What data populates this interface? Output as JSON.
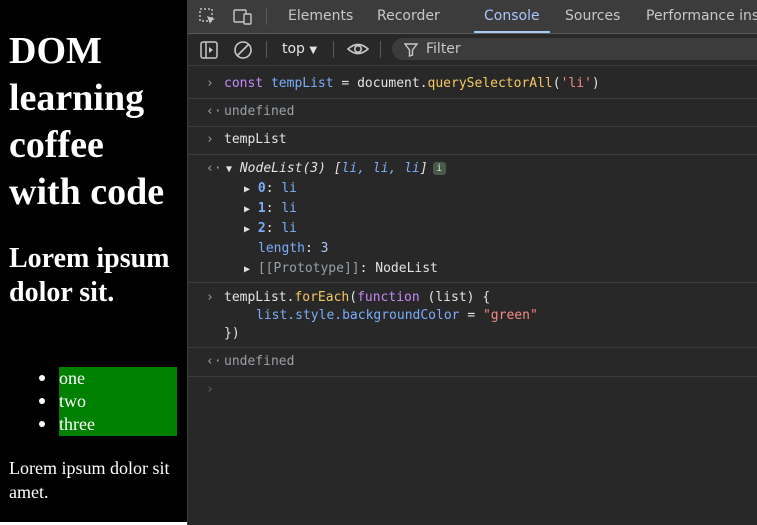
{
  "page": {
    "heading": "DOM learning coffee with code",
    "subheading": "Lorem ipsum dolor sit.",
    "list_items": [
      "one",
      "two",
      "three"
    ],
    "paragraph": "Lorem ipsum dolor sit amet."
  },
  "devtools": {
    "tabs": [
      "Elements",
      "Recorder",
      "Console",
      "Sources",
      "Performance insi"
    ],
    "active_tab": "Console",
    "context": "top",
    "filter_placeholder": "Filter"
  },
  "console": {
    "l1": {
      "kw": "const",
      "var": "tempList",
      "eq": " = ",
      "obj": "document.",
      "fn": "querySelectorAll",
      "p1": "(",
      "str": "'li'",
      "p2": ")"
    },
    "r1": "undefined",
    "l2": "tempList",
    "r2": {
      "head": "NodeList(3) [",
      "items": "li, li, li",
      "tail": "]",
      "badge": "i"
    },
    "nodes": [
      {
        "key": "0",
        "val": "li"
      },
      {
        "key": "1",
        "val": "li"
      },
      {
        "key": "2",
        "val": "li"
      }
    ],
    "length_key": "length",
    "length_val": "3",
    "proto_key": "[[Prototype]]",
    "proto_val": "NodeList",
    "l3a": {
      "var": "tempList.",
      "fn": "forEach",
      "p": "(",
      "kw": "function",
      "args": " (list) {"
    },
    "l3b": {
      "prop": "list.style.backgroundColor",
      "eq": " = ",
      "str": "\"green\""
    },
    "l3c": "})",
    "r3": "undefined"
  },
  "colors": {
    "list_bg": "#008000",
    "accent": "#a8c7fa"
  }
}
